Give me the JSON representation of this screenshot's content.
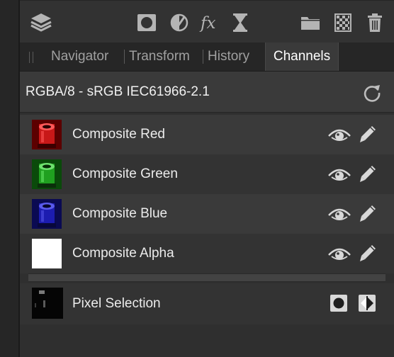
{
  "toolbar": {
    "icons": [
      "layers-stack-icon",
      "mask-icon",
      "adjustment-icon",
      "fx-icon",
      "hourglass-icon",
      "folder-icon",
      "checkerboard-icon",
      "trash-icon"
    ]
  },
  "tabs": [
    {
      "label": "Navigator",
      "active": false
    },
    {
      "label": "Transform",
      "active": false
    },
    {
      "label": "History",
      "active": false
    },
    {
      "label": "Channels",
      "active": true
    }
  ],
  "profile": {
    "text": "RGBA/8 - sRGB IEC61966-2.1"
  },
  "channels": [
    {
      "label": "Composite Red",
      "color": "#c81818"
    },
    {
      "label": "Composite Green",
      "color": "#20a020"
    },
    {
      "label": "Composite Blue",
      "color": "#1c1cb0"
    },
    {
      "label": "Composite Alpha",
      "color": "#ffffff"
    }
  ],
  "pixel_selection": {
    "label": "Pixel Selection"
  }
}
